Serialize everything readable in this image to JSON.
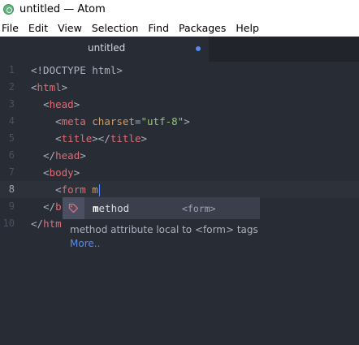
{
  "window": {
    "title": "untitled — Atom"
  },
  "menu": [
    "File",
    "Edit",
    "View",
    "Selection",
    "Find",
    "Packages",
    "Help"
  ],
  "tab": {
    "title": "untitled",
    "modified": true
  },
  "editor": {
    "line_numbers": [
      "1",
      "2",
      "3",
      "4",
      "5",
      "6",
      "7",
      "8",
      "9",
      "10"
    ],
    "active_line": "8",
    "lines": {
      "l1": "<!DOCTYPE html>",
      "l2_open": "<",
      "l2_tag": "html",
      "l2_close": ">",
      "l3_open": "<",
      "l3_tag": "head",
      "l3_close": ">",
      "l4_open": "<",
      "l4_tag": "meta",
      "l4_attr": "charset",
      "l4_eq": "=",
      "l4_str": "\"utf-8\"",
      "l4_close": ">",
      "l5_open": "<",
      "l5_tag": "title",
      "l5_mid": "></",
      "l5_tag2": "title",
      "l5_close": ">",
      "l6_open": "</",
      "l6_tag": "head",
      "l6_close": ">",
      "l7_open": "<",
      "l7_tag": "body",
      "l7_close": ">",
      "l8_open": "<",
      "l8_tag": "form",
      "l8_rest": " m",
      "l9_open": "</",
      "l9_tag": "b",
      "l10_open": "</",
      "l10_tag": "htm"
    }
  },
  "autocomplete": {
    "icon": "tag-icon",
    "match": "m",
    "suggestion_rest": "ethod",
    "context": "<form>",
    "description": "method attribute local to <form> tags",
    "more_link": "More.."
  },
  "colors": {
    "background": "#282c34",
    "tag": "#e06c75",
    "attribute": "#d19a66",
    "string": "#98c379",
    "accent": "#568af2"
  }
}
